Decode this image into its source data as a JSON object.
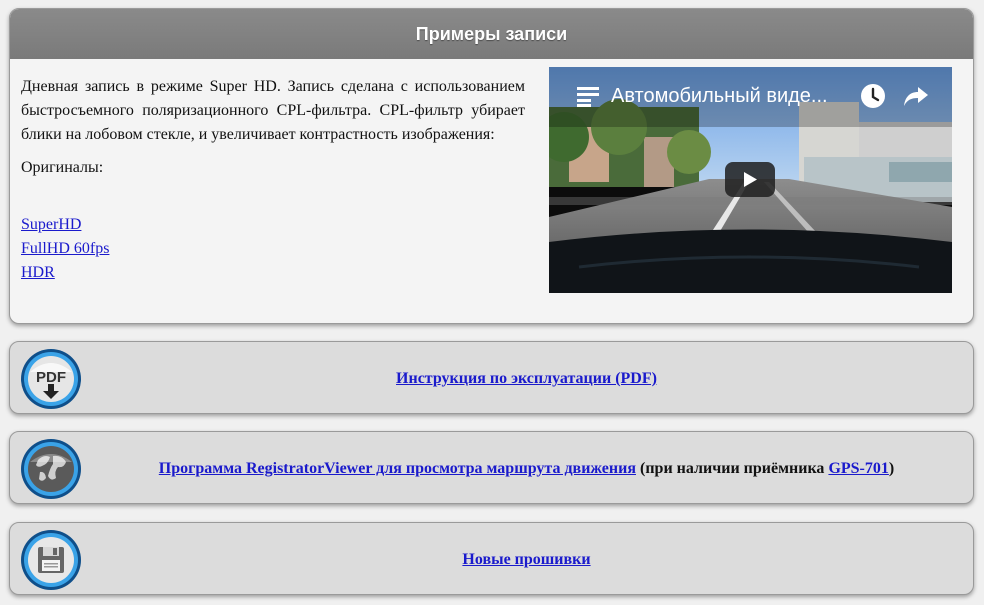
{
  "examples": {
    "title": "Примеры записи",
    "description": "Дневная запись в режиме Super HD. Запись сделана с использованием быстросъемного поляризационного CPL-фильтра. CPL-фильтр убирает блики на лобовом стекле, и  увеличивает контрастность изображения:",
    "originals_label": "Оригиналы:",
    "links": [
      "SuperHD",
      "FullHD 60fps",
      "HDR"
    ],
    "video": {
      "title": "Автомобильный виде...",
      "playlist_icon": "playlist-icon",
      "watch_later_icon": "clock-icon",
      "share_icon": "share-icon",
      "play_icon": "play-icon"
    }
  },
  "manual": {
    "icon": "pdf-download-icon",
    "icon_text": "PDF",
    "link_text": "Инструкция по эксплуатации (PDF)"
  },
  "viewer": {
    "icon": "globe-icon",
    "link_text": "Программа RegistratorViewer для просмотра маршрута движения",
    "text_before_gps": " (при наличии приёмника ",
    "gps_link": "GPS-701",
    "text_after_gps": ")"
  },
  "firmware": {
    "icon": "floppy-disk-icon",
    "link_text": "Новые прошивки"
  },
  "colors": {
    "header_bg": "#808080",
    "link": "#1a1acc",
    "panel_bg": "#dcdcdc",
    "icon_ring": "#1e7fd0"
  }
}
